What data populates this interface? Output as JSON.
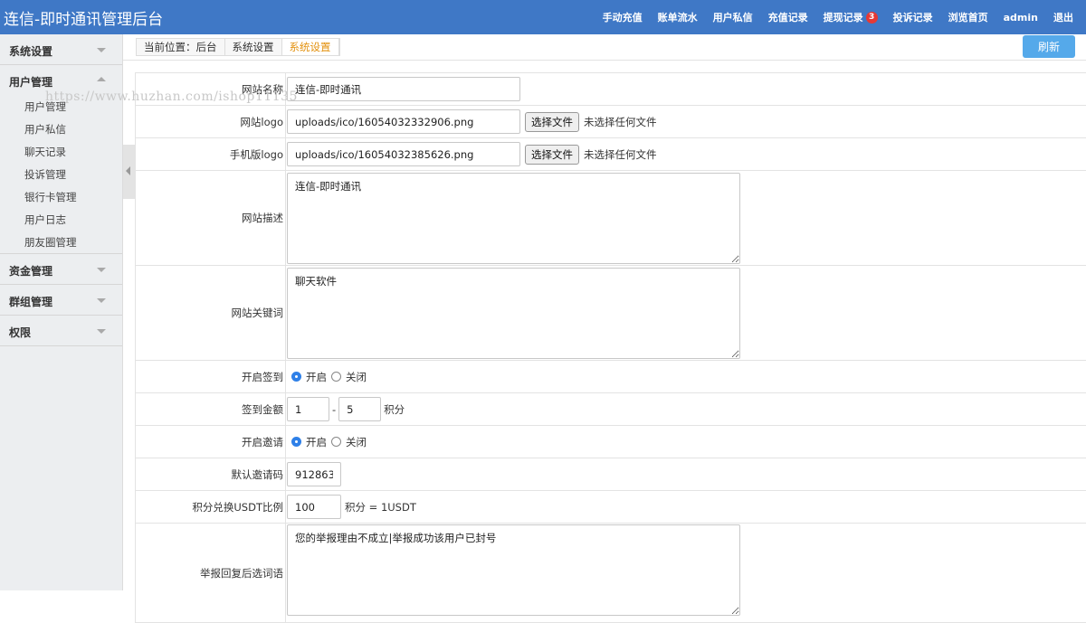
{
  "app": {
    "title": "连信-即时通讯管理后台"
  },
  "topnav": [
    {
      "label": "手动充值"
    },
    {
      "label": "账单流水"
    },
    {
      "label": "用户私信"
    },
    {
      "label": "充值记录"
    },
    {
      "label": "提现记录",
      "badge": "3"
    },
    {
      "label": "投诉记录"
    },
    {
      "label": "浏览首页"
    },
    {
      "label": "admin"
    },
    {
      "label": "退出"
    }
  ],
  "sidebar": {
    "groups": [
      {
        "label": "系统设置"
      },
      {
        "label": "用户管理",
        "items": [
          "用户管理",
          "用户私信",
          "聊天记录",
          "投诉管理",
          "银行卡管理",
          "用户日志",
          "朋友圈管理"
        ]
      },
      {
        "label": "资金管理"
      },
      {
        "label": "群组管理"
      },
      {
        "label": "权限"
      }
    ]
  },
  "breadcrumb": [
    "当前位置：后台",
    "系统设置",
    "系统设置"
  ],
  "toolbar": {
    "refresh_label": "刷新"
  },
  "watermark": "https://www.huzhan.com/ishop11135",
  "form": {
    "site_name": {
      "label": "网站名称",
      "value": "连信-即时通讯"
    },
    "site_logo": {
      "label": "网站logo",
      "value": "uploads/ico/16054032332906.png",
      "button": "选择文件",
      "status": "未选择任何文件"
    },
    "mobile_logo": {
      "label": "手机版logo",
      "value": "uploads/ico/16054032385626.png",
      "button": "选择文件",
      "status": "未选择任何文件"
    },
    "description": {
      "label": "网站描述",
      "value": "连信-即时通讯"
    },
    "keywords": {
      "label": "网站关键词",
      "value": "聊天软件"
    },
    "checkin": {
      "label": "开启签到",
      "on_label": "开启",
      "off_label": "关闭",
      "selected": "开启"
    },
    "checkin_amount": {
      "label": "签到金额",
      "min": "1",
      "sep": "-",
      "max": "5",
      "unit": "积分"
    },
    "invite": {
      "label": "开启邀请",
      "on_label": "开启",
      "off_label": "关闭",
      "selected": "开启"
    },
    "invite_code": {
      "label": "默认邀请码",
      "value": "912863"
    },
    "usdt_ratio": {
      "label": "积分兑换USDT比例",
      "value": "100",
      "suffix": "积分 = 1USDT"
    },
    "report_reply": {
      "label": "举报回复后选词语",
      "value": "您的举报理由不成立|举报成功该用户已封号"
    }
  }
}
